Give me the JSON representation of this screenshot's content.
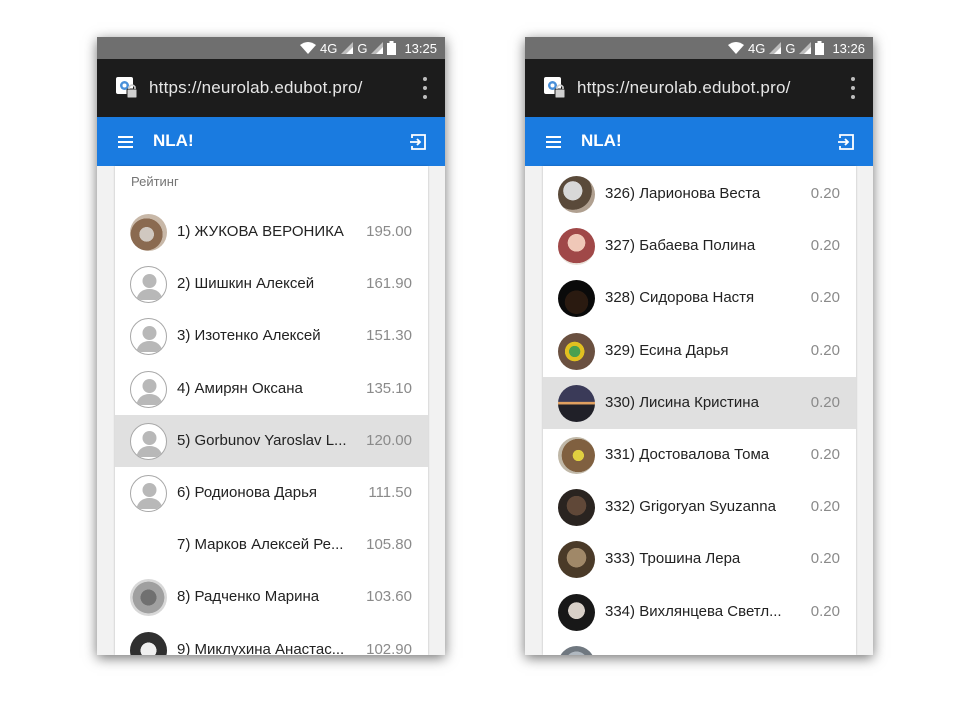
{
  "screens": [
    {
      "status_bar": {
        "network1": "4G",
        "network2": "G",
        "time": "13:25"
      },
      "url": "https://neurolab.edubot.pro/",
      "app_title": "NLA!",
      "section_title": "Рейтинг",
      "rows": [
        {
          "label": "1) ЖУКОВА ВЕРОНИКА",
          "score": "195.00",
          "avatar": "photo"
        },
        {
          "label": "2) Шишкин Алексей",
          "score": "161.90",
          "avatar": "default"
        },
        {
          "label": "3) Изотенко Алексей",
          "score": "151.30",
          "avatar": "default"
        },
        {
          "label": "4) Амирян Оксана",
          "score": "135.10",
          "avatar": "default"
        },
        {
          "label": "5) Gorbunov Yaroslav L...",
          "score": "120.00",
          "avatar": "default",
          "selected": true
        },
        {
          "label": "6) Родионова Дарья",
          "score": "111.50",
          "avatar": "default"
        },
        {
          "label": "7) Марков Алексей Ре...",
          "score": "105.80",
          "avatar": "none"
        },
        {
          "label": "8) Радченко Марина",
          "score": "103.60",
          "avatar": "photo"
        },
        {
          "label": "9) Миклухина Анастас...",
          "score": "102.90",
          "avatar": "photo"
        }
      ]
    },
    {
      "status_bar": {
        "network1": "4G",
        "network2": "G",
        "time": "13:26"
      },
      "url": "https://neurolab.edubot.pro/",
      "app_title": "NLA!",
      "section_title": "",
      "rows": [
        {
          "label": "326) Ларионова Веста",
          "score": "0.20",
          "avatar": "photo"
        },
        {
          "label": "327) Бабаева Полина",
          "score": "0.20",
          "avatar": "photo"
        },
        {
          "label": "328) Сидорова Настя",
          "score": "0.20",
          "avatar": "photo"
        },
        {
          "label": "329) Есина Дарья",
          "score": "0.20",
          "avatar": "photo"
        },
        {
          "label": "330) Лисина Кристина",
          "score": "0.20",
          "avatar": "photo",
          "selected": true
        },
        {
          "label": "331) Достовалова Тома",
          "score": "0.20",
          "avatar": "photo"
        },
        {
          "label": "332) Grigoryan Syuzanna",
          "score": "0.20",
          "avatar": "photo"
        },
        {
          "label": "333) Трошина Лера",
          "score": "0.20",
          "avatar": "photo"
        },
        {
          "label": "334) Вихлянцева Светл...",
          "score": "0.20",
          "avatar": "photo"
        },
        {
          "label": "",
          "score": "",
          "avatar": "photo"
        }
      ]
    }
  ],
  "colors": {
    "app_bar": "#1a7be0",
    "url_bar": "#1c1c1c",
    "status_bar": "#6f6f6f",
    "selected_row": "#e0e0e0",
    "score_text": "#8a8a8a"
  },
  "icons": {
    "site": "site-security-icon",
    "menu": "hamburger-menu-icon",
    "logout": "logout-icon",
    "overflow": "more-vert-icon",
    "wifi": "wifi-icon",
    "signal": "signal-icon",
    "battery": "battery-icon",
    "default_avatar": "user-silhouette-icon"
  }
}
